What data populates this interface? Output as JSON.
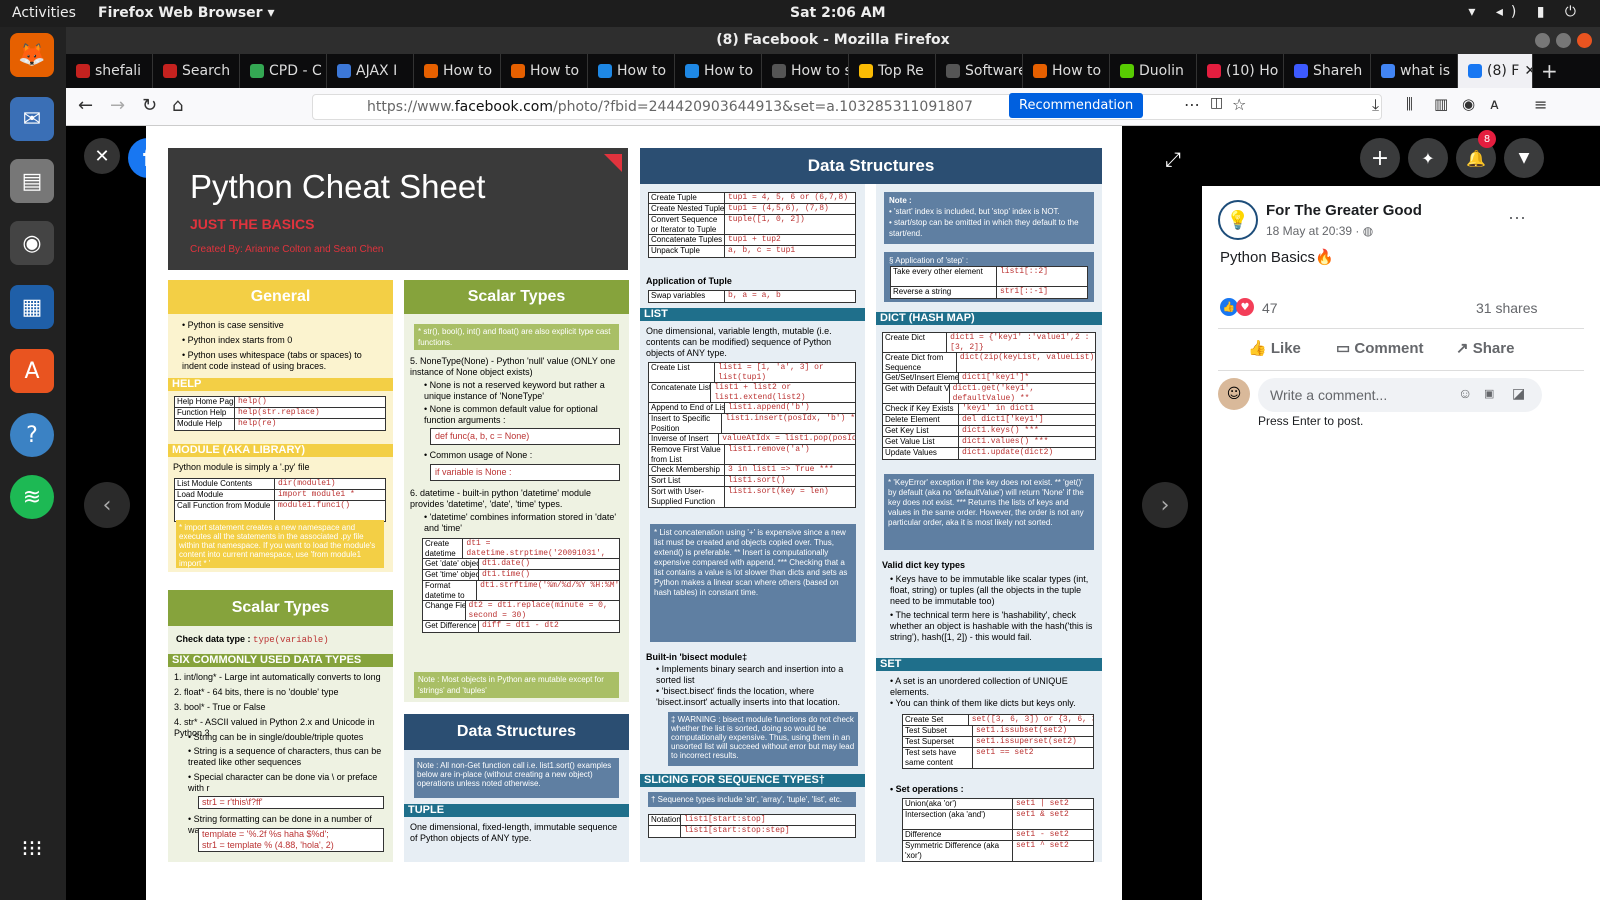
{
  "topbar": {
    "activities": "Activities",
    "app": "Firefox Web Browser ▾",
    "clock": "Sat  2:06 AM",
    "sys": "▾ ◂) ▮ ⏻"
  },
  "window": {
    "title": "(8) Facebook - Mozilla Firefox"
  },
  "tabs": [
    "shefali",
    "Search",
    "CPD - C",
    "AJAX I",
    "How to",
    "How to",
    "How to",
    "How to",
    "How to sta",
    "Top Re",
    "Software",
    "How to",
    "Duolin",
    "(10) Ho",
    "Shareh",
    "what is",
    "(8) F"
  ],
  "url": {
    "prefix": "https://www.",
    "domain": "facebook.com",
    "path": "/photo/?fbid=244420903644913&set=a.103285311091807",
    "recommendation": "Recommendation"
  },
  "sheet": {
    "title": "Python Cheat Sheet",
    "subtitle": "JUST THE BASICS",
    "credit": "Created By: Arianne Colton and Sean Chen",
    "general": {
      "heading": "General",
      "items": [
        "Python is case sensitive",
        "Python index starts from 0",
        "Python uses whitespace (tabs or spaces) to indent code instead of using braces."
      ]
    },
    "help": {
      "heading": "HELP",
      "rows": [
        [
          "Help Home Page",
          "help()"
        ],
        [
          "Function Help",
          "help(str.replace)"
        ],
        [
          "Module Help",
          "help(re)"
        ]
      ]
    },
    "module": {
      "heading": "MODULE (AKA LIBRARY)",
      "intro": "Python module is simply a '.py' file",
      "rows": [
        [
          "List Module Contents",
          "dir(module1)"
        ],
        [
          "Load Module",
          "import module1 *"
        ],
        [
          "Call Function from Module",
          "module1.func1()"
        ]
      ],
      "note": "* import statement creates a new namespace and executes all the statements in the associated .py file within that namespace. If you want to load the module's content into current namespace, use 'from module1 import * '"
    },
    "scalar_left": {
      "heading": "Scalar Types",
      "check": "Check data type :",
      "check_code": "type(variable)",
      "six_heading": "SIX COMMONLY USED DATA TYPES",
      "items": [
        "1.  int/long* - Large int automatically converts to long",
        "2.  float* - 64 bits, there is no 'double' type",
        "3.  bool* - True or False",
        "4.  str* - ASCII valued in Python 2.x and Unicode in Python 3"
      ],
      "bullets": [
        "String can be in single/double/triple quotes",
        "String is a sequence of characters, thus can be treated like other sequences",
        "Special character can be done via \\ or preface with r"
      ],
      "code1": "str1 = r'this\\f?ff'",
      "bullet4": "String formatting can be done in a number of ways",
      "code2": "template = '%.2f %s haha $%d';",
      "code3": "str1 = template % (4.88, 'hola', 2)"
    },
    "scalar_mid": {
      "heading": "Scalar Types",
      "note": "* str(), bool(), int() and float() are also explicit type cast functions.",
      "n5": "5.  NoneType(None) - Python 'null' value (ONLY one instance of None object exists)",
      "b1": "None is not a reserved keyword but rather a unique instance of 'NoneType'",
      "b2": "None is common default value for optional function arguments :",
      "c1": "def func(a, b, c = None)",
      "b3": "Common usage of None :",
      "c2": "if variable is None :",
      "n6": "6.  datetime - built-in python 'datetime' module provides 'datetime', 'date', 'time' types.",
      "b4": "'datetime' combines information stored in 'date' and 'time'",
      "rows": [
        [
          "Create datetime from String",
          "dt1 = datetime.strptime('20091031', '%Y%m%d')"
        ],
        [
          "Get 'date' object",
          "dt1.date()"
        ],
        [
          "Get 'time' object",
          "dt1.time()"
        ],
        [
          "Format datetime to String",
          "dt1.strftime('%m/%d/%Y %H:%M')"
        ],
        [
          "Change Field Value",
          "dt2 = dt1.replace(minute = 0, second = 30)"
        ],
        [
          "Get Difference",
          "diff = dt1 - dt2"
        ]
      ],
      "footnote": "Note : Most objects in Python are mutable except for 'strings' and 'tuples'"
    },
    "ds_mid": {
      "heading": "Data Structures",
      "note": "Note : All non-Get function call i.e. list1.sort() examples below are in-place (without creating a new object) operations unless noted otherwise.",
      "tuple": "TUPLE",
      "tuple_desc": "One dimensional, fixed-length, immutable sequence of Python objects of ANY type."
    },
    "ds_right": {
      "heading": "Data Structures",
      "tuple_rows": [
        [
          "Create Tuple",
          "tup1 = 4, 5, 6 or (6,7,8)"
        ],
        [
          "Create Nested Tuple",
          "tup1 = (4,5,6), (7,8)"
        ],
        [
          "Convert Sequence or Iterator to Tuple",
          "tuple([1, 0, 2])"
        ],
        [
          "Concatenate Tuples",
          "tup1 + tup2"
        ],
        [
          "Unpack Tuple",
          "a, b, c = tup1"
        ]
      ],
      "app_tuple": "Application of Tuple",
      "swap": [
        "Swap variables",
        "b, a = a, b"
      ],
      "list": "LIST",
      "list_desc": "One dimensional, variable length, mutable (i.e. contents can be modified) sequence of Python objects of ANY type.",
      "list_rows": [
        [
          "Create List",
          "list1 = [1, 'a', 3] or list(tup1)"
        ],
        [
          "Concatenate Lists*",
          "list1 + list2 or list1.extend(list2)"
        ],
        [
          "Append to End of List",
          "list1.append('b')"
        ],
        [
          "Insert to Specific Position",
          "list1.insert(posIdx, 'b') **"
        ],
        [
          "Inverse of Insert",
          "valueAtIdx = list1.pop(posIdx)"
        ],
        [
          "Remove First Value from List",
          "list1.remove('a')"
        ],
        [
          "Check Membership",
          "3 in list1 => True ***"
        ],
        [
          "Sort List",
          "list1.sort()"
        ],
        [
          "Sort with User-Supplied Function",
          "list1.sort(key = len)"
        ]
      ],
      "list_notes": "* List concatenation using '+' is expensive since a new list must be created and objects copied over. Thus, extend() is preferable.  ** Insert is computationally expensive compared with append.  *** Checking that a list contains a value is lot slower than dicts and sets as Python makes a linear scan where others (based on hash tables) in constant time.",
      "bisect": "Built-in 'bisect module‡",
      "bisect_items": [
        "Implements binary search and insertion into a sorted list",
        "'bisect.bisect' finds the location, where 'bisect.insort' actually inserts into that location."
      ],
      "warning": "‡ WARNING : bisect module functions do not check whether the list is sorted, doing so would be computationally expensive. Thus, using them in an unsorted list will succeed without error but may lead to incorrect results.",
      "slicing": "SLICING FOR SEQUENCE TYPES†",
      "slicing_note": "† Sequence types include 'str', 'array', 'tuple', 'list', etc.",
      "notation_rows": [
        [
          "Notation",
          "list1[start:stop]"
        ],
        [
          "",
          "list1[start:stop:step]"
        ]
      ]
    },
    "ds_far": {
      "note_head": "Note :",
      "note_items": [
        "'start' index is included, but 'stop' index is NOT.",
        "start/stop can be omitted in which they default to the start/end."
      ],
      "step_head": "§ Application of 'step' :",
      "step_rows": [
        [
          "Take every other element",
          "list1[::2]"
        ],
        [
          "Reverse a string",
          "str1[::-1]"
        ]
      ],
      "dict": "DICT (HASH MAP)",
      "dict_rows": [
        [
          "Create Dict",
          "dict1 = {'key1' :'value1',2 :[3, 2]}"
        ],
        [
          "Create Dict from Sequence",
          "dict(zip(keyList, valueList))"
        ],
        [
          "Get/Set/Insert Element",
          "dict1['key1']*"
        ],
        [
          "Get with Default Value",
          "dict1.get('key1', defaultValue) **"
        ],
        [
          "Check if Key Exists",
          "'key1' in dict1"
        ],
        [
          "Delete Element",
          "del dict1['key1']"
        ],
        [
          "Get Key List",
          "dict1.keys() ***"
        ],
        [
          "Get Value List",
          "dict1.values() ***"
        ],
        [
          "Update Values",
          "dict1.update(dict2)"
        ]
      ],
      "dict_notes": "* 'KeyError' exception if the key does not exist.  ** 'get()' by default (aka no 'defaultValue') will return 'None' if the key does not exist.  *** Returns the lists of keys and values in the same order. However, the order is not any particular order, aka it is most likely not sorted.",
      "valid": "Valid dict key types",
      "valid_items": [
        "Keys have to be immutable like scalar types (int, float, string) or tuples (all the objects in the tuple need to be immutable too)",
        "The technical term here is 'hashability', check whether an object is hashable with the hash('this is string'), hash([1, 2]) - this would fail."
      ],
      "set": "SET",
      "set_items": [
        "A set is an unordered collection of UNIQUE elements.",
        "You can think of them like dicts but keys only."
      ],
      "set_rows": [
        [
          "Create Set",
          "set([3, 6, 3]) or {3, 6, 3}"
        ],
        [
          "Test Subset",
          "set1.issubset(set2)"
        ],
        [
          "Test Superset",
          "set1.issuperset(set2)"
        ],
        [
          "Test sets have same content",
          "set1 == set2"
        ]
      ],
      "setops": "Set operations :",
      "setops_rows": [
        [
          "Union(aka 'or')",
          "set1 | set2"
        ],
        [
          "Intersection (aka 'and')",
          "set1 & set2"
        ],
        [
          "Difference",
          "set1 - set2"
        ],
        [
          "Symmetric Difference (aka 'xor')",
          "set1 ^ set2"
        ]
      ]
    }
  },
  "post": {
    "author": "For The Greater Good",
    "date": "18 May at 20:39 · ",
    "text": "Python Basics🔥",
    "reactions": "47",
    "shares": "31 shares",
    "like": "Like",
    "comment": "Comment",
    "share": "Share",
    "comment_placeholder": "Write a comment...",
    "press_enter": "Press Enter to post.",
    "notif_count": "8"
  },
  "colors": {
    "yellow": "#f3cf45",
    "green": "#86a33c",
    "navy": "#2b4e72",
    "teal": "#1f6f8b",
    "panel_blue": "#e7eef4",
    "panel_yellow": "#fbf3cf",
    "panel_green": "#eef2e2"
  }
}
